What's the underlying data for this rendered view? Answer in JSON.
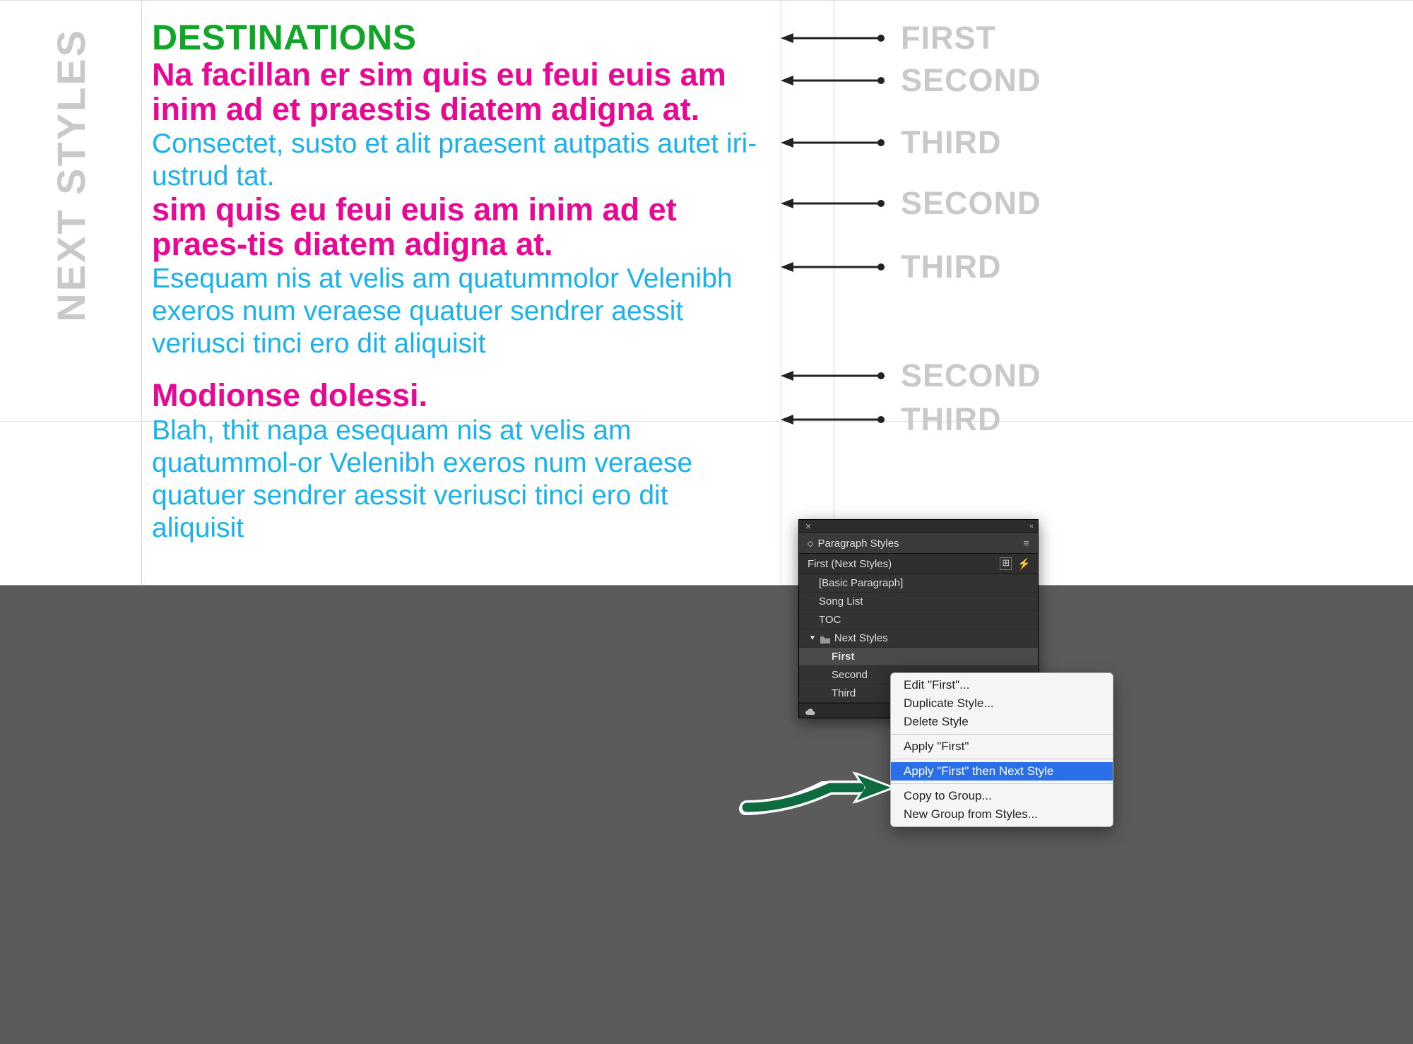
{
  "sideLabel": "NEXT STYLES",
  "content": {
    "p1": "DESTINATIONS",
    "p2": "Na facillan er sim quis eu feui euis am inim ad et praestis diatem adigna at.",
    "p3": "Consectet, susto et alit praesent autpatis autet iri-ustrud tat.",
    "p4": "sim quis eu feui euis am inim ad et praes-tis diatem adigna at.",
    "p5": "Esequam nis at velis am quatummolor Velenibh exeros num veraese quatuer sendrer aessit veriusci tinci ero dit aliquisit",
    "p6": "Modionse dolessi.",
    "p7": "Blah, thit napa esequam nis at velis am quatummol-or Velenibh exeros num veraese quatuer sendrer aessit veriusci tinci ero dit aliquisit"
  },
  "labels": {
    "l1": "FIRST",
    "l2": "SECOND",
    "l3": "THIRD",
    "l4": "SECOND",
    "l5": "THIRD",
    "l6": "SECOND",
    "l7": "THIRD"
  },
  "panel": {
    "title": "Paragraph Styles",
    "current": "First (Next Styles)",
    "items": {
      "basic": "[Basic Paragraph]",
      "song": "Song List",
      "toc": "TOC",
      "group": "Next Styles",
      "n1": "First",
      "n2": "Second",
      "n3": "Third"
    }
  },
  "context": {
    "edit": "Edit \"First\"...",
    "dup": "Duplicate Style...",
    "del": "Delete Style",
    "apply": "Apply \"First\"",
    "applyNext": "Apply \"First\" then Next Style",
    "copy": "Copy to Group...",
    "newGroup": "New Group from Styles..."
  }
}
